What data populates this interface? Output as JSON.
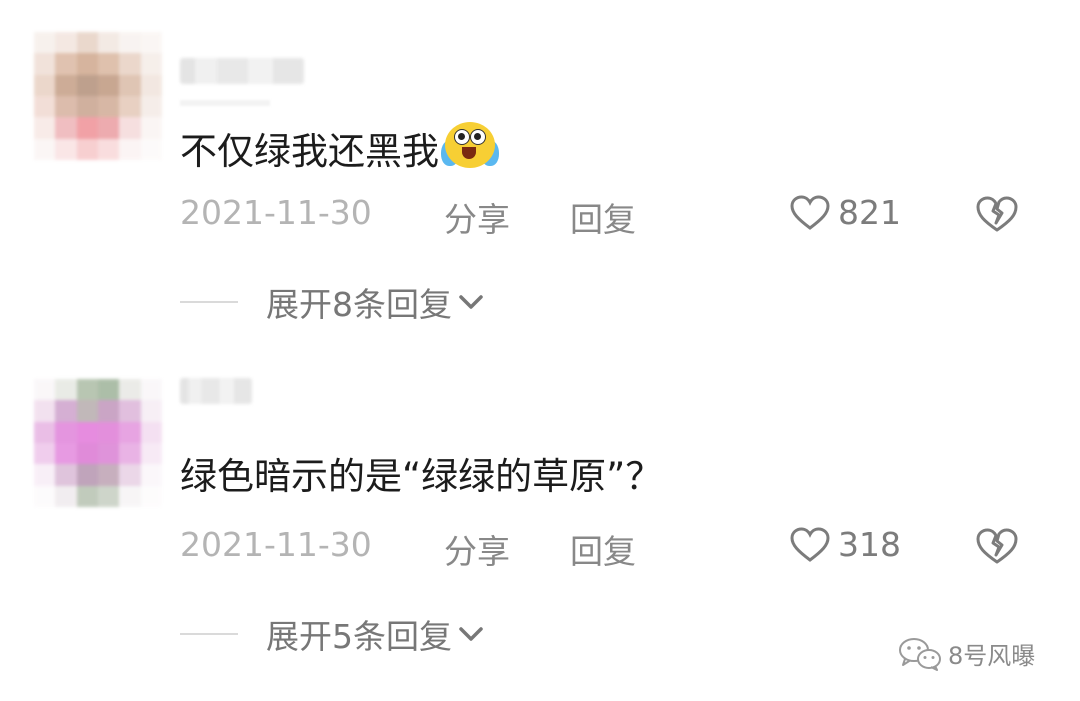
{
  "comments": [
    {
      "text": "不仅绿我还黑我",
      "date": "2021-11-30",
      "share_label": "分享",
      "reply_label": "回复",
      "likes": "821",
      "expand_label": "展开8条回复"
    },
    {
      "text": "绿色暗示的是“绿绿的草原”？",
      "date": "2021-11-30",
      "share_label": "分享",
      "reply_label": "回复",
      "likes": "318",
      "expand_label": "展开5条回复"
    }
  ],
  "watermark": "8号风曝",
  "icons": {
    "like": "heart-outline-icon",
    "dislike": "broken-heart-icon",
    "expand": "chevron-down-icon",
    "emoji": "tears-of-joy-emoji",
    "watermark": "wechat-icon"
  },
  "colors": {
    "text": "#1c1c1c",
    "meta": "#b0b0b0",
    "action": "#888888"
  }
}
